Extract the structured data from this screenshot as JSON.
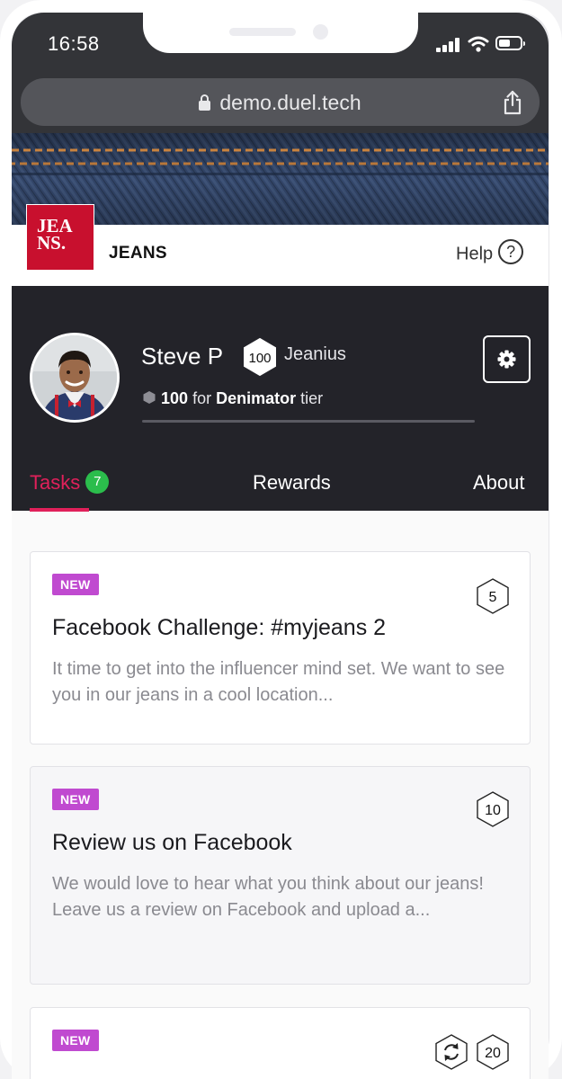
{
  "status_bar": {
    "time": "16:58"
  },
  "browser": {
    "url": "demo.duel.tech"
  },
  "brand": {
    "logo_line1": "JEA",
    "logo_line2": "NS.",
    "name": "JEANS",
    "help_label": "Help",
    "help_glyph": "?"
  },
  "profile": {
    "name": "Steve P",
    "points": "100",
    "tier": "Jeanius",
    "next_tier_points": "100",
    "next_tier_prefix": "for",
    "next_tier_name": "Denimator",
    "next_tier_suffix": "tier",
    "progress_fraction": 0.0
  },
  "tabs": [
    {
      "label": "Tasks",
      "count": "7",
      "active": true
    },
    {
      "label": "Rewards",
      "active": false
    },
    {
      "label": "About",
      "active": false
    }
  ],
  "tasks": [
    {
      "tag": "NEW",
      "title": "Facebook Challenge: #myjeans 2",
      "description": "It time to get into the influencer mind set. We want to see you in our jeans in a cool location...",
      "points": "5"
    },
    {
      "tag": "NEW",
      "title": "Review us on Facebook",
      "description": "We would love to hear what you think about our jeans! Leave us a review on Facebook and upload a...",
      "points": "10"
    },
    {
      "tag": "NEW",
      "title": "",
      "description": "",
      "points": "20",
      "repeatable_icon": "refresh-icon"
    }
  ],
  "colors": {
    "accent": "#e0205a",
    "brand_red": "#c8102e",
    "tag_purple": "#c04ad0",
    "count_green": "#2bbd4c",
    "header_dark": "#232329"
  }
}
